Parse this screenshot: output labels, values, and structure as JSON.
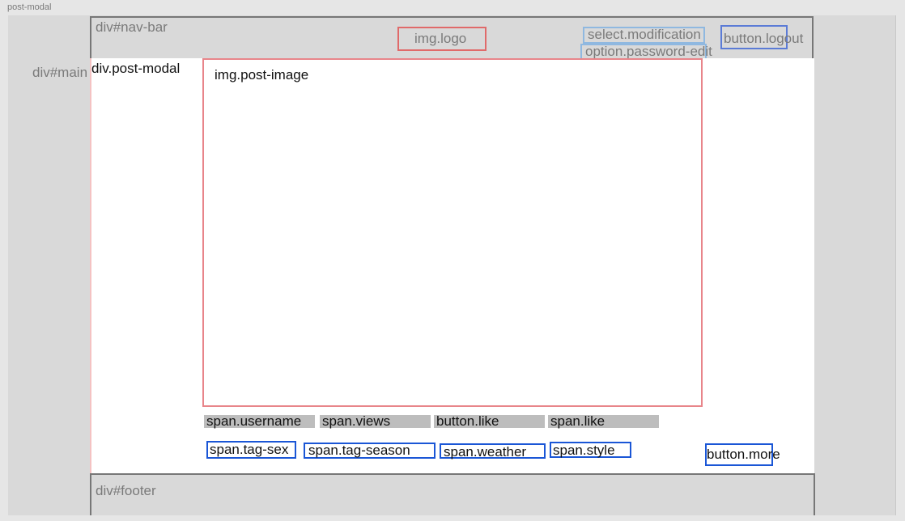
{
  "frame_title": "post-modal",
  "nav": {
    "label": "div#nav-bar",
    "logo": "img.logo",
    "select": "select.modification",
    "option": "option.password-edit",
    "logout": "button.logout"
  },
  "main": {
    "label": "div#main",
    "modal_label": "div.post-modal",
    "image_label": "img.post-image",
    "meta": {
      "username": "span.username",
      "views": "span.views",
      "like_button": "button.like",
      "like_count": "span.like"
    },
    "tags": {
      "sex": "span.tag-sex",
      "season": "span.tag-season",
      "weather": "span.weather",
      "style": "span.style"
    },
    "more_button": "button.more"
  },
  "footer": {
    "label": "div#footer"
  }
}
